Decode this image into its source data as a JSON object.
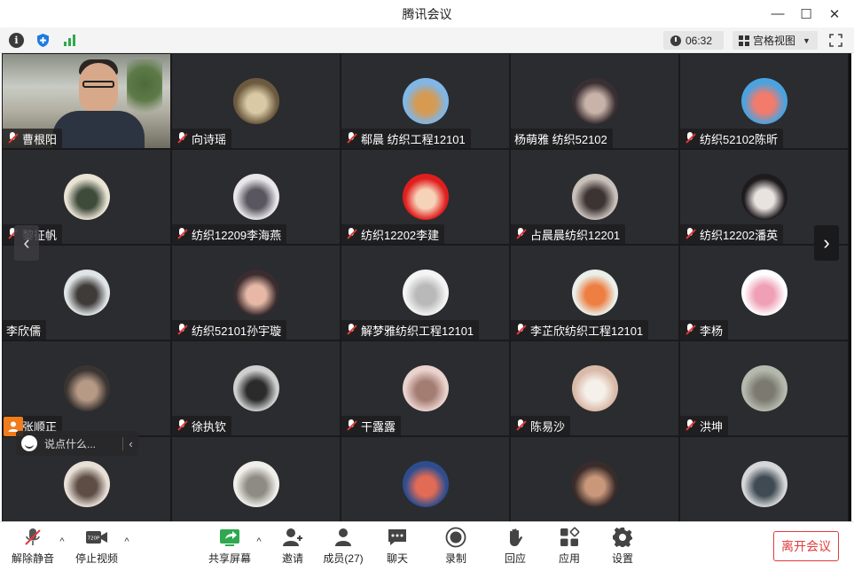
{
  "window": {
    "title": "腾讯会议",
    "minimize": "—",
    "maximize": "☐",
    "close": "✕"
  },
  "infobar": {
    "info_icon": "i",
    "timer": "06:32",
    "view_label": "宫格视图",
    "view_caret": "▼"
  },
  "tiles": [
    {
      "name": "曹根阳",
      "camera": true
    },
    {
      "name": "向诗瑶",
      "avatar_color": "#6b5a3e",
      "avatar_accent": "#d9c9a4"
    },
    {
      "name": "郗晨 纺织工程12101",
      "avatar_color": "#7fb7e8",
      "avatar_accent": "#d69a52"
    },
    {
      "name": "杨萌雅 纺织52102",
      "muted": false,
      "avatar_color": "#3a2f33",
      "avatar_accent": "#c9b3a8"
    },
    {
      "name": "纺织52102陈昕",
      "avatar_color": "#4aa3e0",
      "avatar_accent": "#f27b6c"
    },
    {
      "name": "黎征帆",
      "avatar_color": "#e9e3d4",
      "avatar_accent": "#3e4a3a"
    },
    {
      "name": "纺织12209李海燕",
      "avatar_color": "#e8e6ea",
      "avatar_accent": "#5a5660"
    },
    {
      "name": "纺织12202李建",
      "avatar_color": "#e01e1e",
      "avatar_accent": "#f6d3b8"
    },
    {
      "name": "占晨晨纺织12201",
      "avatar_color": "#c9bfb9",
      "avatar_accent": "#3b3433"
    },
    {
      "name": "纺织12202潘英",
      "avatar_color": "#1f1b1d",
      "avatar_accent": "#e9e3e0"
    },
    {
      "name": "李欣儒",
      "muted": false,
      "avatar_color": "#dfe5e6",
      "avatar_accent": "#3f3b39"
    },
    {
      "name": "纺织52101孙宇璇",
      "avatar_color": "#3b2c2f",
      "avatar_accent": "#e6b8a5"
    },
    {
      "name": "解梦雅纺织工程12101",
      "avatar_color": "#f4f4f4",
      "avatar_accent": "#b9b9b9"
    },
    {
      "name": "李芷欣纺织工程12101",
      "avatar_color": "#e9f0ea",
      "avatar_accent": "#ee7e42"
    },
    {
      "name": "李杨",
      "avatar_color": "#fdfdfd",
      "avatar_accent": "#f0a0b6"
    },
    {
      "name": "张顺正",
      "avatar_color": "#3a3532",
      "avatar_accent": "#b79a86"
    },
    {
      "name": "徐执钦",
      "avatar_color": "#cfcfcf",
      "avatar_accent": "#2b2b2b"
    },
    {
      "name": "干露露",
      "avatar_color": "#ead2cd",
      "avatar_accent": "#a47d72"
    },
    {
      "name": "陈易沙",
      "avatar_color": "#d9b9a8",
      "avatar_accent": "#f5f1ea"
    },
    {
      "name": "洪坤",
      "avatar_color": "#b5b9ad",
      "avatar_accent": "#7c7a70"
    },
    {
      "name": "",
      "avatar_color": "#e8dfd6",
      "avatar_accent": "#5d4d45"
    },
    {
      "name": "",
      "avatar_color": "#f0efe9",
      "avatar_accent": "#8e8a84"
    },
    {
      "name": "",
      "avatar_color": "#2e4d8f",
      "avatar_accent": "#e26b55"
    },
    {
      "name": "",
      "avatar_color": "#3a2c2a",
      "avatar_accent": "#c9977a"
    },
    {
      "name": "",
      "avatar_color": "#d4d6d8",
      "avatar_accent": "#3f4a52"
    }
  ],
  "grid_nav": {
    "prev": "‹",
    "next": "›"
  },
  "chat": {
    "placeholder": "说点什么...",
    "collapse": "‹"
  },
  "toolbar": {
    "mute": "解除静音",
    "stop_video": "停止视频",
    "share_screen": "共享屏幕",
    "invite": "邀请",
    "members": "成员(27)",
    "chat": "聊天",
    "record": "录制",
    "reaction": "回应",
    "apps": "应用",
    "settings": "设置",
    "leave": "离开会议",
    "video_badge": "720P",
    "caret": "^"
  },
  "colors": {
    "tile_bg": "#2b2c30",
    "accent_green": "#2fa84f",
    "leave_red": "#e23b3b",
    "host_orange": "#f07c1c"
  }
}
